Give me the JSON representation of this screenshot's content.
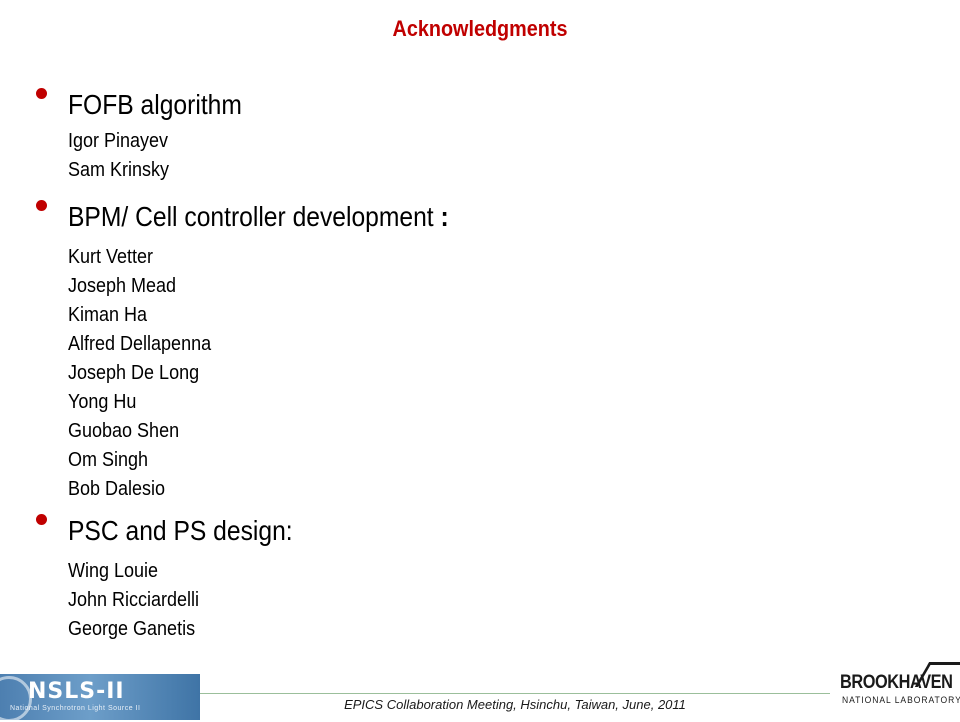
{
  "slide": {
    "title": "Acknowledgments",
    "sections": [
      {
        "heading": "FOFB algorithm",
        "names": [
          "Igor Pinayev",
          "Sam Krinsky"
        ]
      },
      {
        "heading": "BPM/ Cell controller development",
        "heading_suffix": ":",
        "names": [
          "Kurt Vetter",
          "Joseph Mead",
          "Kiman Ha",
          "Alfred Dellapenna",
          "Joseph  De Long",
          "Yong Hu",
          "Guobao Shen",
          "Om Singh",
          "Bob Dalesio"
        ]
      },
      {
        "heading": "PSC and PS design:",
        "names": [
          "Wing Louie",
          "John Ricciardelli",
          "George Ganetis"
        ]
      }
    ]
  },
  "footer": {
    "text": "EPICS Collaboration Meeting, Hsinchu, Taiwan, June, 2011",
    "left_logo": {
      "mark": "NSLS-II",
      "subtitle": "National Synchrotron Light Source II"
    },
    "right_logo": {
      "word": "BROOKHAVEN",
      "subtitle": "NATIONAL LABORATORY"
    }
  },
  "colors": {
    "title": "#c00000",
    "bullet": "#c00000",
    "text": "#000000"
  }
}
